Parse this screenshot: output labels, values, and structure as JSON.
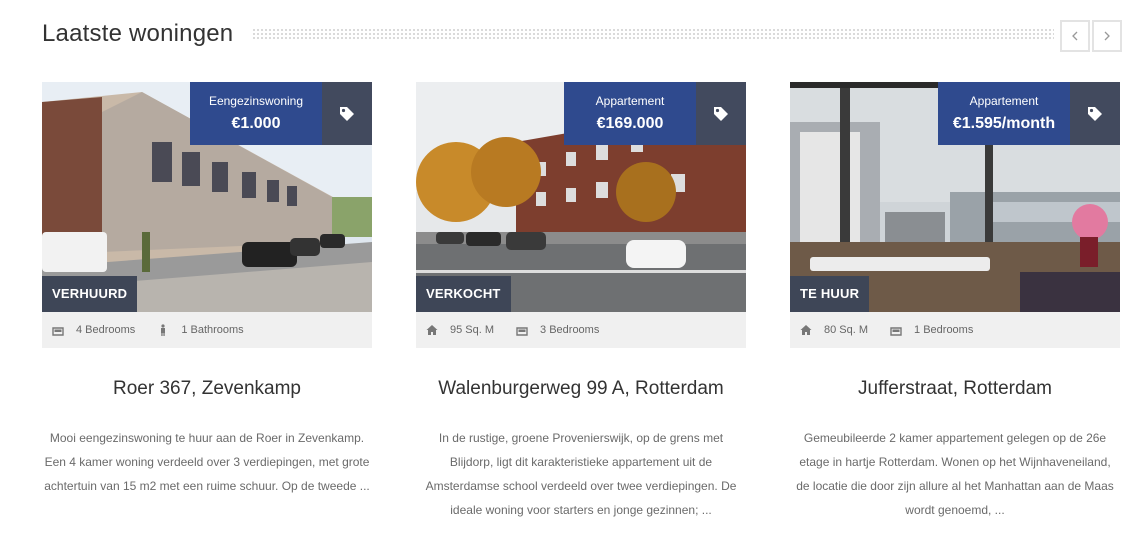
{
  "section": {
    "title": "Laatste woningen"
  },
  "nav": {
    "prev_icon": "chevron-left-icon",
    "next_icon": "chevron-right-icon"
  },
  "colors": {
    "price_bg": "#2f4a8e",
    "tag_bg": "#424a5e",
    "status_bg": "#3e4657",
    "meta_bg": "#f0f0f0"
  },
  "listings": [
    {
      "type": "Eengezinswoning",
      "price": "€1.000",
      "status": "VERHUURD",
      "meta": [
        {
          "icon": "bed-icon",
          "label": "4 Bedrooms"
        },
        {
          "icon": "person-icon",
          "label": "1 Bathrooms"
        }
      ],
      "title": "Roer 367, Zevenkamp",
      "description": "Mooi eengezinswoning te huur aan de Roer in Zevenkamp. Een 4 kamer woning verdeeld over 3 verdiepingen, met grote achtertuin van 15 m2 met een  ruime schuur. Op de tweede ..."
    },
    {
      "type": "Appartement",
      "price": "€169.000",
      "status": "VERKOCHT",
      "meta": [
        {
          "icon": "home-icon",
          "label": "95 Sq. M"
        },
        {
          "icon": "bed-icon",
          "label": "3 Bedrooms"
        }
      ],
      "title": "Walenburgerweg 99 A, Rotterdam",
      "description": "In de rustige, groene Provenierswijk, op de grens met Blijdorp, ligt dit karakteristieke appartement uit de Amsterdamse school verdeeld over twee verdiepingen. De ideale woning voor starters en jonge gezinnen; ..."
    },
    {
      "type": "Appartement",
      "price": "€1.595/month",
      "status": "TE HUUR",
      "meta": [
        {
          "icon": "home-icon",
          "label": "80 Sq. M"
        },
        {
          "icon": "bed-icon",
          "label": "1 Bedrooms"
        }
      ],
      "title": "Jufferstraat, Rotterdam",
      "description": "Gemeubileerde 2 kamer appartement gelegen op de 26e etage in hartje Rotterdam. Wonen op het Wijnhaveneiland, de locatie die door zijn allure al het Manhattan aan de Maas wordt genoemd, ..."
    }
  ]
}
